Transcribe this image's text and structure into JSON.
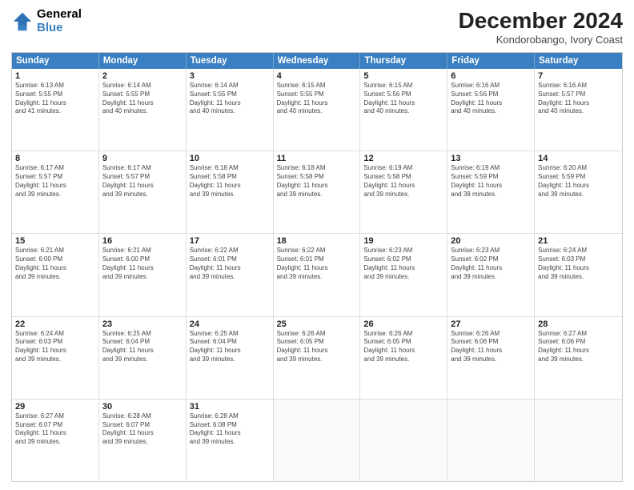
{
  "logo": {
    "general": "General",
    "blue": "Blue"
  },
  "header": {
    "month": "December 2024",
    "location": "Kondorobango, Ivory Coast"
  },
  "weekdays": [
    "Sunday",
    "Monday",
    "Tuesday",
    "Wednesday",
    "Thursday",
    "Friday",
    "Saturday"
  ],
  "weeks": [
    [
      {
        "day": "1",
        "info": "Sunrise: 6:13 AM\nSunset: 5:55 PM\nDaylight: 11 hours\nand 41 minutes."
      },
      {
        "day": "2",
        "info": "Sunrise: 6:14 AM\nSunset: 5:55 PM\nDaylight: 11 hours\nand 40 minutes."
      },
      {
        "day": "3",
        "info": "Sunrise: 6:14 AM\nSunset: 5:55 PM\nDaylight: 11 hours\nand 40 minutes."
      },
      {
        "day": "4",
        "info": "Sunrise: 6:15 AM\nSunset: 5:55 PM\nDaylight: 11 hours\nand 40 minutes."
      },
      {
        "day": "5",
        "info": "Sunrise: 6:15 AM\nSunset: 5:56 PM\nDaylight: 11 hours\nand 40 minutes."
      },
      {
        "day": "6",
        "info": "Sunrise: 6:16 AM\nSunset: 5:56 PM\nDaylight: 11 hours\nand 40 minutes."
      },
      {
        "day": "7",
        "info": "Sunrise: 6:16 AM\nSunset: 5:57 PM\nDaylight: 11 hours\nand 40 minutes."
      }
    ],
    [
      {
        "day": "8",
        "info": "Sunrise: 6:17 AM\nSunset: 5:57 PM\nDaylight: 11 hours\nand 39 minutes."
      },
      {
        "day": "9",
        "info": "Sunrise: 6:17 AM\nSunset: 5:57 PM\nDaylight: 11 hours\nand 39 minutes."
      },
      {
        "day": "10",
        "info": "Sunrise: 6:18 AM\nSunset: 5:58 PM\nDaylight: 11 hours\nand 39 minutes."
      },
      {
        "day": "11",
        "info": "Sunrise: 6:18 AM\nSunset: 5:58 PM\nDaylight: 11 hours\nand 39 minutes."
      },
      {
        "day": "12",
        "info": "Sunrise: 6:19 AM\nSunset: 5:58 PM\nDaylight: 11 hours\nand 39 minutes."
      },
      {
        "day": "13",
        "info": "Sunrise: 6:19 AM\nSunset: 5:59 PM\nDaylight: 11 hours\nand 39 minutes."
      },
      {
        "day": "14",
        "info": "Sunrise: 6:20 AM\nSunset: 5:59 PM\nDaylight: 11 hours\nand 39 minutes."
      }
    ],
    [
      {
        "day": "15",
        "info": "Sunrise: 6:21 AM\nSunset: 6:00 PM\nDaylight: 11 hours\nand 39 minutes."
      },
      {
        "day": "16",
        "info": "Sunrise: 6:21 AM\nSunset: 6:00 PM\nDaylight: 11 hours\nand 39 minutes."
      },
      {
        "day": "17",
        "info": "Sunrise: 6:22 AM\nSunset: 6:01 PM\nDaylight: 11 hours\nand 39 minutes."
      },
      {
        "day": "18",
        "info": "Sunrise: 6:22 AM\nSunset: 6:01 PM\nDaylight: 11 hours\nand 39 minutes."
      },
      {
        "day": "19",
        "info": "Sunrise: 6:23 AM\nSunset: 6:02 PM\nDaylight: 11 hours\nand 39 minutes."
      },
      {
        "day": "20",
        "info": "Sunrise: 6:23 AM\nSunset: 6:02 PM\nDaylight: 11 hours\nand 39 minutes."
      },
      {
        "day": "21",
        "info": "Sunrise: 6:24 AM\nSunset: 6:03 PM\nDaylight: 11 hours\nand 39 minutes."
      }
    ],
    [
      {
        "day": "22",
        "info": "Sunrise: 6:24 AM\nSunset: 6:03 PM\nDaylight: 11 hours\nand 39 minutes."
      },
      {
        "day": "23",
        "info": "Sunrise: 6:25 AM\nSunset: 6:04 PM\nDaylight: 11 hours\nand 39 minutes."
      },
      {
        "day": "24",
        "info": "Sunrise: 6:25 AM\nSunset: 6:04 PM\nDaylight: 11 hours\nand 39 minutes."
      },
      {
        "day": "25",
        "info": "Sunrise: 6:26 AM\nSunset: 6:05 PM\nDaylight: 11 hours\nand 39 minutes."
      },
      {
        "day": "26",
        "info": "Sunrise: 6:26 AM\nSunset: 6:05 PM\nDaylight: 11 hours\nand 39 minutes."
      },
      {
        "day": "27",
        "info": "Sunrise: 6:26 AM\nSunset: 6:06 PM\nDaylight: 11 hours\nand 39 minutes."
      },
      {
        "day": "28",
        "info": "Sunrise: 6:27 AM\nSunset: 6:06 PM\nDaylight: 11 hours\nand 39 minutes."
      }
    ],
    [
      {
        "day": "29",
        "info": "Sunrise: 6:27 AM\nSunset: 6:07 PM\nDaylight: 11 hours\nand 39 minutes."
      },
      {
        "day": "30",
        "info": "Sunrise: 6:28 AM\nSunset: 6:07 PM\nDaylight: 11 hours\nand 39 minutes."
      },
      {
        "day": "31",
        "info": "Sunrise: 6:28 AM\nSunset: 6:08 PM\nDaylight: 11 hours\nand 39 minutes."
      },
      {
        "day": "",
        "info": ""
      },
      {
        "day": "",
        "info": ""
      },
      {
        "day": "",
        "info": ""
      },
      {
        "day": "",
        "info": ""
      }
    ]
  ]
}
